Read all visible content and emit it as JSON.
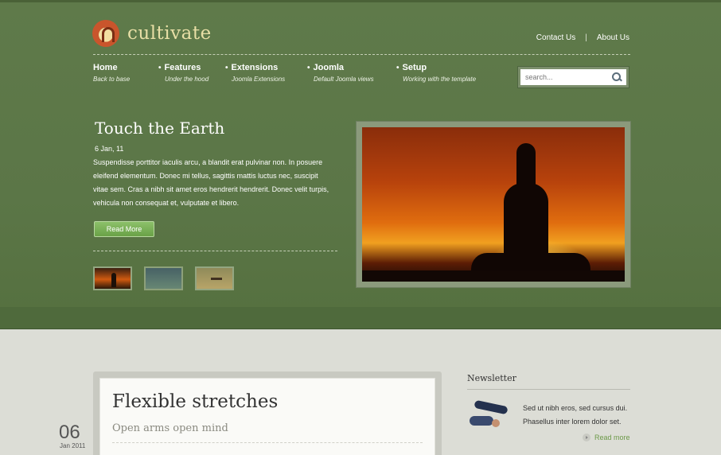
{
  "site": {
    "name": "cultivate"
  },
  "top_links": {
    "contact": "Contact Us",
    "separator": "|",
    "about": "About Us"
  },
  "nav": [
    {
      "title": "Home",
      "subtitle": "Back to base"
    },
    {
      "title": "Features",
      "subtitle": "Under the hood"
    },
    {
      "title": "Extensions",
      "subtitle": "Joomla Extensions"
    },
    {
      "title": "Joomla",
      "subtitle": "Default Joomla views"
    },
    {
      "title": "Setup",
      "subtitle": "Working with the template"
    }
  ],
  "search": {
    "placeholder": "search..."
  },
  "feature": {
    "title": "Touch the Earth",
    "date": "6 Jan, 11",
    "body": "Suspendisse porttitor iaculis arcu, a blandit erat pulvinar non. In posuere eleifend elementum. Donec mi tellus, sagittis mattis luctus nec, suscipit vitae sem. Cras a nibh sit amet eros hendrerit hendrerit. Donec velit turpis, vehicula non consequat et, vulputate et libero.",
    "button": "Read More"
  },
  "post": {
    "title": "Flexible stretches",
    "subtitle": "Open arms open mind",
    "day": "06",
    "month_year": "Jan 2011"
  },
  "newsletter": {
    "title": "Newsletter",
    "text": "Sed ut nibh eros, sed cursus dui. Phasellus inter lorem dolor set.",
    "more": "Read more"
  },
  "colors": {
    "hero_green": "#5b7647",
    "accent_green": "#6aa247",
    "logo_text": "#e8dfa6"
  }
}
